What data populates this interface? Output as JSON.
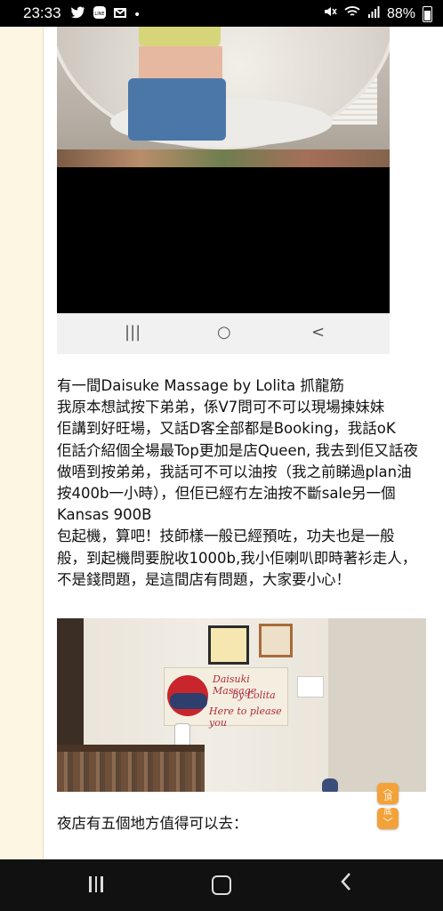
{
  "status_bar": {
    "time": "23:33",
    "battery": "88%",
    "app_icons": [
      "twitter-icon",
      "line-icon",
      "gmail-icon",
      "dot-icon"
    ],
    "system_icons": [
      "mute-icon",
      "wifi-icon",
      "signal-icon",
      "battery-icon"
    ]
  },
  "inner_nav": {
    "recents": "|||",
    "home": "○",
    "back": "<"
  },
  "article": {
    "lines": [
      "有一間Daisuke Massage by Lolita 抓龍筋",
      "我原本想試按下弟弟，係V7問可不可以現場揀妹妹",
      "佢講到好旺場，又話D客全部都是Booking，我話oK",
      "佢話介紹個全場最Top更加是店Queen, 我去到佢又話夜",
      "做唔到按弟弟，我話可不可以油按（我之前睇過plan油",
      "按400b一小時），但佢已經冇左油按不斷sale另一個",
      "Kansas 900B",
      "包起機，算吧！技師樣一般已經預咗，功夫也是一般",
      "般，到起機問要脫收1000b,我小佢喇叭即時著衫走人，",
      "不是錢問題，是這間店有問題，大家要小心！"
    ]
  },
  "shop_sign": {
    "line1": "Daisuki Massage",
    "line2": "by Lolita",
    "line3": "Here to please you"
  },
  "closing_text": "夜店有五個地方值得可以去：",
  "scroll_buttons": {
    "top": "頂",
    "bottom": "底"
  },
  "colors": {
    "scroll_button": "#f3a23a",
    "left_strip": "#fdf6e3"
  }
}
